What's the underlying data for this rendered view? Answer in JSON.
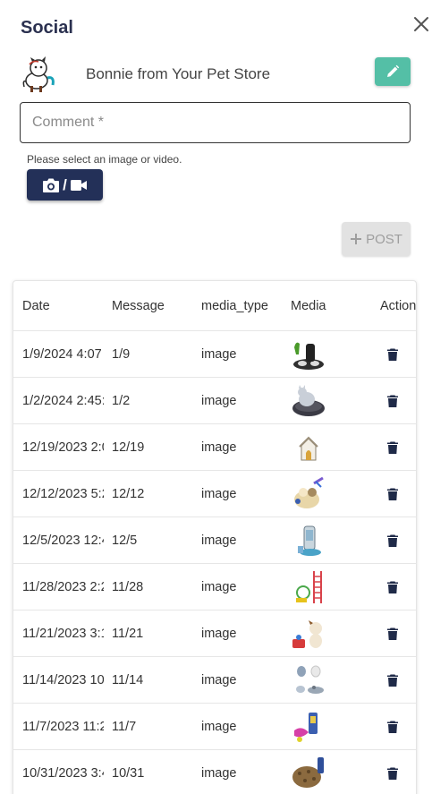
{
  "panel": {
    "title": "Social"
  },
  "store": {
    "name": "Bonnie from Your Pet Store"
  },
  "comment": {
    "placeholder": "Comment *",
    "value": ""
  },
  "media": {
    "hint": "Please select an image or video.",
    "slash": "/"
  },
  "post": {
    "label": "POST"
  },
  "table": {
    "headers": {
      "date": "Date",
      "message": "Message",
      "media_type": "media_type",
      "media": "Media",
      "action": "Action"
    },
    "rows": [
      {
        "date": "1/9/2024 4:07",
        "message": "1/9",
        "media_type": "image"
      },
      {
        "date": "1/2/2024 2:45:",
        "message": "1/2",
        "media_type": "image"
      },
      {
        "date": "12/19/2023 2:0",
        "message": "12/19",
        "media_type": "image"
      },
      {
        "date": "12/12/2023 5:2",
        "message": "12/12",
        "media_type": "image"
      },
      {
        "date": "12/5/2023 12:4",
        "message": "12/5",
        "media_type": "image"
      },
      {
        "date": "11/28/2023 2:2",
        "message": "11/28",
        "media_type": "image"
      },
      {
        "date": "11/21/2023 3:1",
        "message": "11/21",
        "media_type": "image"
      },
      {
        "date": "11/14/2023 10:",
        "message": "11/14",
        "media_type": "image"
      },
      {
        "date": "11/7/2023 11:2",
        "message": "11/7",
        "media_type": "image"
      },
      {
        "date": "10/31/2023 3:4",
        "message": "10/31",
        "media_type": "image"
      }
    ]
  }
}
